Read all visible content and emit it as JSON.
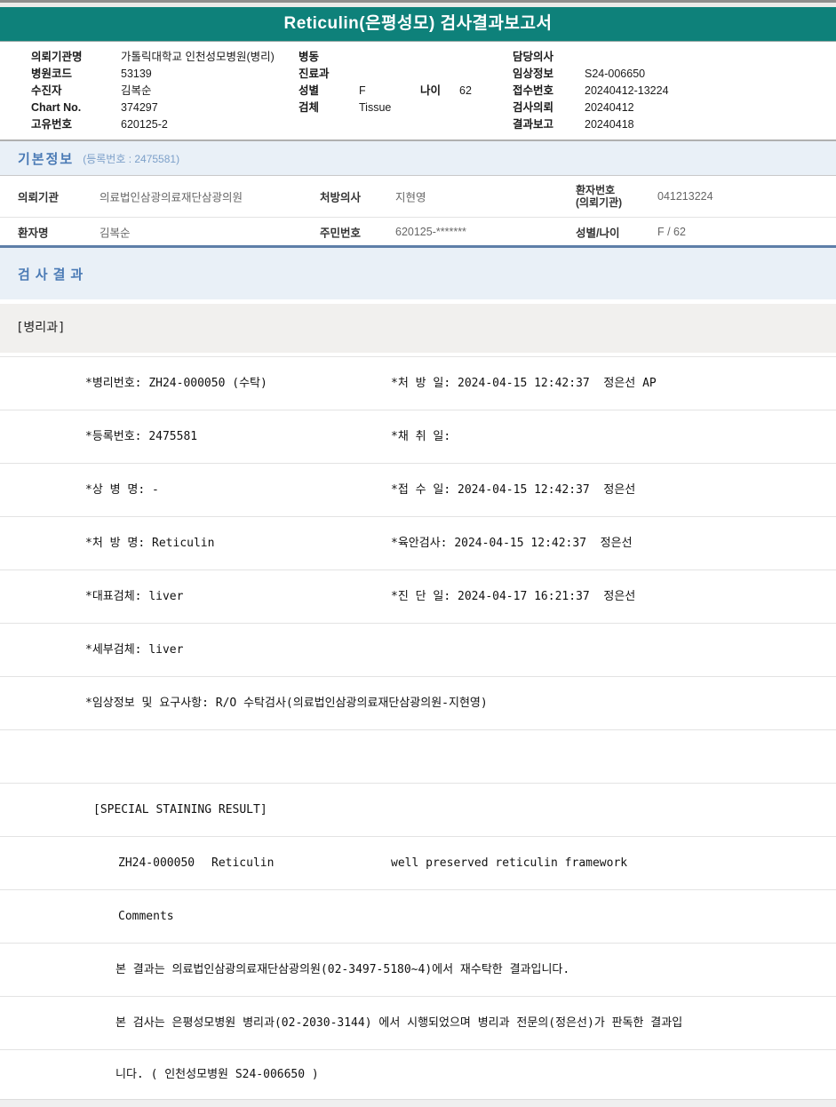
{
  "title": "Reticulin(은평성모) 검사결과보고서",
  "patient_header": {
    "left": [
      {
        "label": "의뢰기관명",
        "value": "가톨릭대학교 인천성모병원(병리)"
      },
      {
        "label": "병원코드",
        "value": "53139"
      },
      {
        "label": "수진자",
        "value": "김복순"
      },
      {
        "label": "Chart No.",
        "value": "374297"
      },
      {
        "label": "고유번호",
        "value": "620125-2"
      }
    ],
    "middle": [
      {
        "label": "병동",
        "value": ""
      },
      {
        "label": "진료과",
        "value": ""
      },
      {
        "label": "성별",
        "value": "F",
        "label2": "나이",
        "value2": "62"
      },
      {
        "label": "검체",
        "value": "Tissue"
      }
    ],
    "right": [
      {
        "label": "담당의사",
        "value": ""
      },
      {
        "label": "임상정보",
        "value": "S24-006650"
      },
      {
        "label": "접수번호",
        "value": "20240412-13224"
      },
      {
        "label": "검사의뢰",
        "value": "20240412"
      },
      {
        "label": "결과보고",
        "value": "20240418"
      }
    ]
  },
  "basic_info": {
    "section_title": "기본정보",
    "subtitle": "(등록번호 : 2475581)",
    "rows": [
      [
        {
          "label": "의뢰기관",
          "value": "의료법인삼광의료재단삼광의원"
        },
        {
          "label": "처방의사",
          "value": "지현영"
        },
        {
          "label": "환자번호\n(의뢰기관)",
          "value": "041213224"
        }
      ],
      [
        {
          "label": "환자명",
          "value": "김복순"
        },
        {
          "label": "주민번호",
          "value": "620125-*******"
        },
        {
          "label": "성별/나이",
          "value": "F / 62"
        }
      ]
    ]
  },
  "test_results": {
    "section_title": "검사결과",
    "department": "[병리과]",
    "detail_rows": [
      {
        "left": "*병리번호: ZH24-000050 (수탁)",
        "right": "*처 방 일: 2024-04-15 12:42:37  정은선 AP"
      },
      {
        "left": "*등록번호: 2475581",
        "right": "*채 취 일:"
      },
      {
        "left": "*상 병 명: -",
        "right": "*접 수 일: 2024-04-15 12:42:37  정은선"
      },
      {
        "left": "*처 방 명: Reticulin",
        "right": "*육안검사: 2024-04-15 12:42:37  정은선"
      },
      {
        "left": "*대표검체: liver",
        "right": "*진 단 일: 2024-04-17 16:21:37  정은선"
      },
      {
        "left": "*세부검체: liver"
      },
      {
        "left": "*임상정보 및 요구사항: R/O 수탁검사(의료법인삼광의료재단삼광의원-지현영)"
      }
    ],
    "staining_header": "[SPECIAL STAINING RESULT]",
    "staining_row": {
      "code": "ZH24-000050",
      "stain": "Reticulin",
      "result": "well preserved reticulin framework"
    },
    "comments_label": "Comments",
    "comments": [
      "본 결과는 의료법인삼광의료재단삼광의원(02-3497-5180~4)에서 재수탁한 결과입니다.",
      "본 검사는 은평성모병원 병리과(02-2030-3144) 에서 시행되었으며 병리과 전문의(정은선)가 판독한 결과입",
      "니다. ( 인천성모병원 S24-006650 )"
    ]
  }
}
